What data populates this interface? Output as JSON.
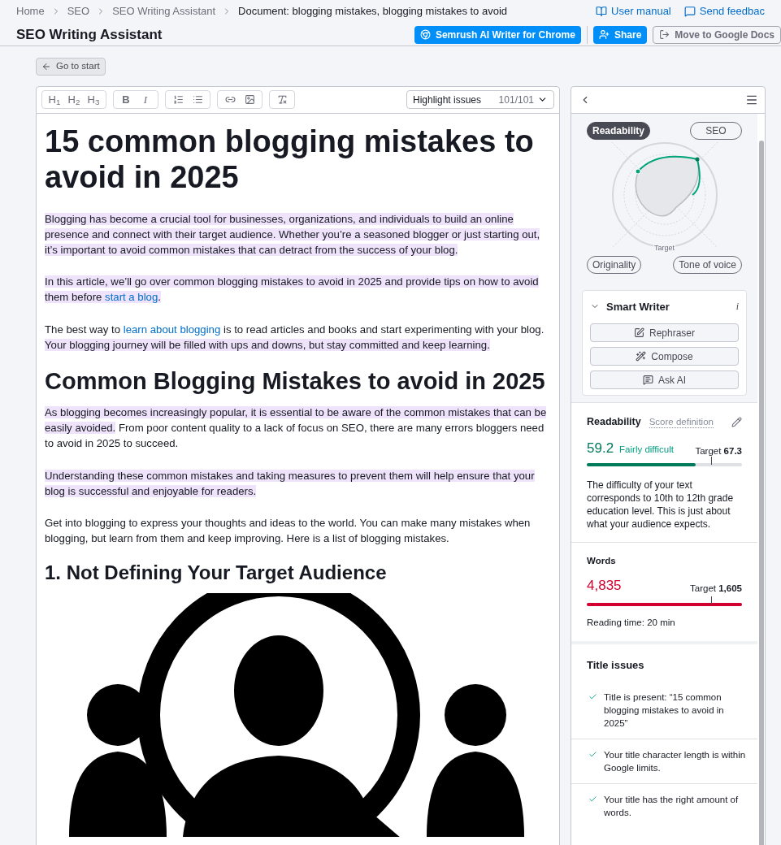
{
  "breadcrumbs": [
    "Home",
    "SEO",
    "SEO Writing Assistant",
    "Document: blogging mistakes, blogging mistakes to avoid"
  ],
  "header_links": [
    {
      "label": "User manual"
    },
    {
      "label": "Send feedbac"
    }
  ],
  "title": "SEO Writing Assistant",
  "header_buttons": [
    {
      "label": "Semrush AI Writer for Chrome",
      "kind": "primary"
    },
    {
      "label": "Share",
      "kind": "primary"
    },
    {
      "label": "Move to Google Docs",
      "kind": "secondary"
    }
  ],
  "go_to_start": "Go to start",
  "toolbar": {
    "groups": [
      [
        {
          "kind": "text",
          "label": "H$_{1}$"
        },
        {
          "kind": "text",
          "label": "H$_{2}$"
        },
        {
          "kind": "text",
          "label": "H$_{3}$"
        }
      ],
      [
        {
          "kind": "bold",
          "label": "B"
        },
        {
          "kind": "italic",
          "label": "I"
        }
      ]
    ],
    "highlight": {
      "label": "Highlight issues",
      "count": "101/101"
    }
  },
  "document": [
    {
      "kind": "h1",
      "text": "15 common blogging mistakes to avoid in 2025"
    },
    {
      "kind": "p",
      "segments": [
        {
          "text": "Blogging has become a crucial tool for businesses, organizations, and individuals to build an online presence and connect with their target audience. Whether you’re a seasoned blogger or just starting out, it’s important to avoid common mistakes that can detract from the success of your blog.",
          "highlighted": true,
          "link": false
        }
      ]
    },
    {
      "kind": "p",
      "segments": [
        {
          "text": "In this article, we’ll go over common blogging mistakes to avoid in 2025 and provide tips on how to avoid them before ",
          "highlighted": true,
          "link": false
        },
        {
          "text": "start a blog",
          "highlighted": true,
          "link": true
        },
        {
          "text": ".",
          "highlighted": true,
          "link": false
        }
      ]
    },
    {
      "kind": "p",
      "segments": [
        {
          "text": "The best way to ",
          "highlighted": false,
          "link": false
        },
        {
          "text": "learn about blogging",
          "highlighted": false,
          "link": true
        },
        {
          "text": " is to read articles and books and start experimenting with your blog. ",
          "highlighted": false,
          "link": false
        },
        {
          "text": "Your blogging journey will be filled with ups and downs, but stay committed and keep learning.",
          "highlighted": true,
          "link": false
        }
      ]
    },
    {
      "kind": "h2",
      "text": "Common Blogging Mistakes to avoid in 2025"
    },
    {
      "kind": "p",
      "segments": [
        {
          "text": "As blogging becomes increasingly popular, it is essential to be aware of the common mistakes that can be easily avoided.",
          "highlighted": true,
          "link": false
        },
        {
          "text": " From poor content quality to a lack of focus on SEO, there are many errors bloggers need to avoid in 2025 to succeed.",
          "highlighted": false,
          "link": false
        }
      ]
    },
    {
      "kind": "p",
      "segments": [
        {
          "text": "Understanding these common mistakes and taking measures to prevent them will help ensure that your blog is successful and enjoyable for readers.",
          "highlighted": true,
          "link": false
        }
      ]
    },
    {
      "kind": "p",
      "segments": [
        {
          "text": "Get into blogging to express your thoughts and ideas to the world. You can make many mistakes when blogging, but learn from them and keep improving. Here is a list of blogging mistakes.",
          "highlighted": false,
          "link": false
        }
      ]
    },
    {
      "kind": "h3",
      "text": "1. Not Defining Your Target Audience"
    },
    {
      "kind": "image"
    }
  ],
  "radar": {
    "tabs": [
      {
        "label": "Readability",
        "selected": true
      },
      {
        "label": "SEO",
        "selected": false
      },
      {
        "label": "Originality",
        "selected": false
      },
      {
        "label": "Tone of voice",
        "selected": false
      }
    ],
    "target_label": "Target"
  },
  "smart_writer": {
    "title": "Smart Writer",
    "expanded": true,
    "info": "i",
    "buttons": [
      "Rephraser",
      "Compose",
      "Ask AI"
    ]
  },
  "readability": {
    "title": "Readability",
    "link": "Score definition",
    "score": "59.2",
    "rating": "Fairly difficult",
    "level": 0.7,
    "target": {
      "label": "Target",
      "value": "67.3",
      "level": 0.8
    },
    "description": "The difficulty of your text corresponds to 10th to 12th grade education level. This is just about what your audience expects."
  },
  "words": {
    "title": "Words",
    "count": "4,835",
    "level": 1,
    "target": {
      "label": "Target",
      "value": "1,605",
      "level": 0.8
    },
    "reading_time": "Reading time: 20 min"
  },
  "title_issues": {
    "title": "Title issues",
    "items": [
      {
        "text": "Title is present: “15 common blogging mistakes to avoid in 2025”",
        "passed": true
      },
      {
        "text": "Your title character length is within Google limits.",
        "passed": true
      },
      {
        "text": "Your title has the right amount of words.",
        "passed": true
      }
    ]
  }
}
